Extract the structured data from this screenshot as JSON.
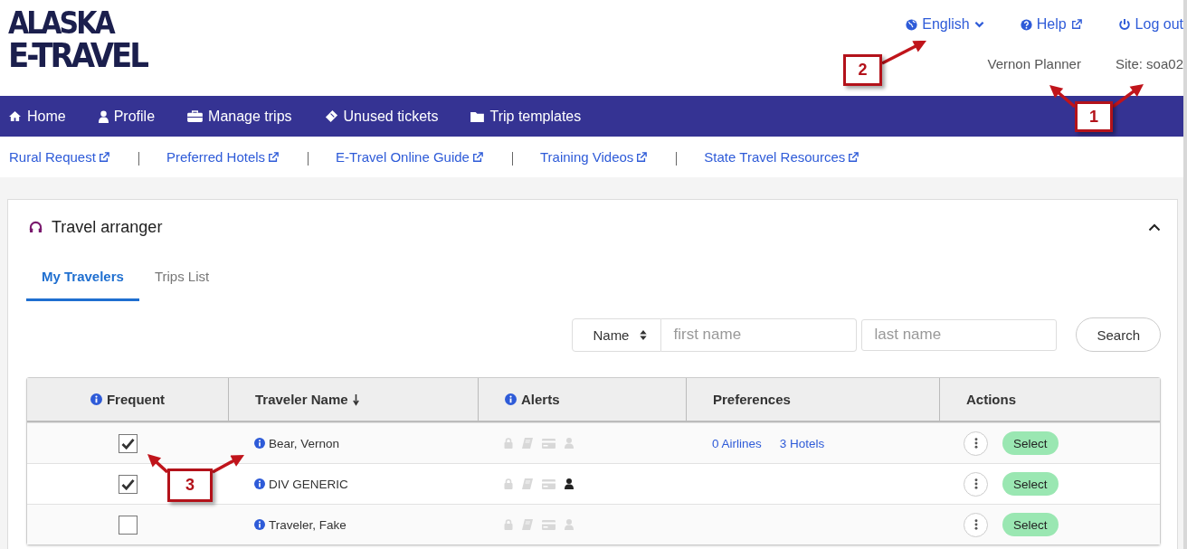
{
  "logo": {
    "line_1": "ALASKA",
    "line_2": "E-TRAVEL"
  },
  "top_links": [
    {
      "kind": "language",
      "label": "English"
    },
    {
      "kind": "help",
      "label": "Help"
    },
    {
      "kind": "logout",
      "label": "Log out"
    }
  ],
  "user": {
    "name": "Vernon Planner",
    "site": "Site: soa02"
  },
  "nav": [
    {
      "kind": "home",
      "label": "Home"
    },
    {
      "kind": "profile",
      "label": "Profile"
    },
    {
      "kind": "trips",
      "label": "Manage trips"
    },
    {
      "kind": "tickets",
      "label": "Unused tickets"
    },
    {
      "kind": "templates",
      "label": "Trip templates"
    }
  ],
  "resource_links": [
    "Rural Request",
    "Preferred Hotels",
    "E-Travel Online Guide",
    "Training Videos",
    "State Travel Resources"
  ],
  "panel": {
    "title": "Travel arranger",
    "expanded": true,
    "tabs": [
      {
        "label": "My Travelers",
        "selected": true
      },
      {
        "label": "Trips List",
        "selected": false
      }
    ],
    "search": {
      "field": "Name",
      "first_placeholder": "first name",
      "last_placeholder": "last name",
      "button": "Search"
    },
    "table": {
      "columns": [
        {
          "label": "Frequent",
          "info": true,
          "sorted": false
        },
        {
          "label": "Traveler Name",
          "info": false,
          "sorted": true
        },
        {
          "label": "Alerts",
          "info": true,
          "sorted": false
        },
        {
          "label": "Preferences",
          "info": false,
          "sorted": false
        },
        {
          "label": "Actions",
          "info": false,
          "sorted": false
        }
      ],
      "rows": [
        {
          "frequent": true,
          "name": "Bear, Vernon",
          "alerts": [
            {
              "kind": "lock",
              "active": false
            },
            {
              "kind": "book",
              "active": false
            },
            {
              "kind": "card",
              "active": false
            },
            {
              "kind": "person",
              "active": false
            }
          ],
          "preferences": [
            "0 Airlines",
            "3 Hotels"
          ],
          "action": "Select"
        },
        {
          "frequent": true,
          "name": "DIV GENERIC",
          "alerts": [
            {
              "kind": "lock",
              "active": false
            },
            {
              "kind": "book",
              "active": false
            },
            {
              "kind": "card",
              "active": false
            },
            {
              "kind": "person",
              "active": true
            }
          ],
          "preferences": [],
          "action": "Select"
        },
        {
          "frequent": false,
          "name": "Traveler, Fake",
          "alerts": [
            {
              "kind": "lock",
              "active": false
            },
            {
              "kind": "book",
              "active": false
            },
            {
              "kind": "card",
              "active": false
            },
            {
              "kind": "person",
              "active": false
            }
          ],
          "preferences": [],
          "action": "Select"
        }
      ]
    }
  },
  "callouts": [
    {
      "label": "2"
    },
    {
      "label": "1"
    },
    {
      "label": "3"
    }
  ]
}
